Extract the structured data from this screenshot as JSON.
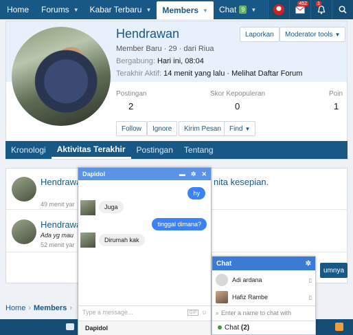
{
  "nav": {
    "items": [
      {
        "label": "Home"
      },
      {
        "label": "Forums"
      },
      {
        "label": "Kabar Terbaru"
      },
      {
        "label": "Members"
      },
      {
        "label": "Chat"
      }
    ],
    "chat_badge": "9",
    "inbox_count": "452",
    "alerts_count": "1"
  },
  "profile": {
    "name": "Hendrawan",
    "meta": "Member Baru · 29 · dari Riua",
    "joined_label": "Bergabung:",
    "joined_value": "Hari ini, 08:04",
    "active_label": "Terakhir Aktif:",
    "active_value": "14 menit yang lalu · Melihat Daftar Forum",
    "report_label": "Laporkan",
    "modtools_label": "Moderator tools",
    "stats": [
      {
        "label": "Postingan",
        "value": "2"
      },
      {
        "label": "Skor Kepopuleran",
        "value": "0"
      },
      {
        "label": "Poin",
        "value": "1"
      }
    ],
    "buttons": {
      "follow": "Follow",
      "ignore": "Ignore",
      "send": "Kirim Pesan",
      "find": "Find"
    }
  },
  "tabs": [
    {
      "label": "Kronologi"
    },
    {
      "label": "Aktivitas Terakhir"
    },
    {
      "label": "Postingan"
    },
    {
      "label": "Tentang"
    }
  ],
  "feed": [
    {
      "title": "Hendrawa",
      "tail": "nita kesepian.",
      "text": "",
      "time": "49 menit yar"
    },
    {
      "title": "Hendrawa",
      "tail": "",
      "text": "Ada yg mau",
      "time": "52 menit yar"
    }
  ],
  "more_button": "umnya",
  "breadcrumb": [
    "Home",
    "Members"
  ],
  "chat_window": {
    "title": "Dapidol",
    "messages": [
      {
        "from": "me",
        "text": "hy"
      },
      {
        "from": "them",
        "text": "Juga"
      },
      {
        "from": "me",
        "text": "tinggal dimana?"
      },
      {
        "from": "them",
        "text": "Dirumah kak"
      }
    ],
    "input_placeholder": "Type a message...",
    "footer_name": "Dapidol"
  },
  "chat_list": {
    "title": "Chat",
    "users": [
      {
        "name": "Adi ardana"
      },
      {
        "name": "Hafiz Rambe"
      }
    ],
    "search_placeholder": "Enter a name to chat with",
    "footer_label": "Chat",
    "footer_count": "(2)"
  },
  "colors": {
    "nav_bg": "#185886",
    "chat_bubble_me": "#3b82f6",
    "online_dot": "#3a9b3a"
  }
}
